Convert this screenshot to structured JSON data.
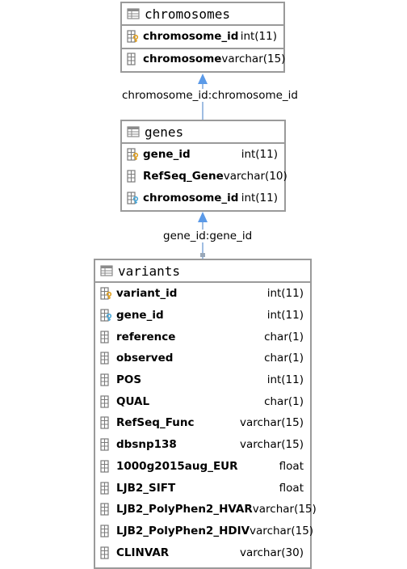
{
  "tables": {
    "chromosomes": {
      "title": "chromosomes",
      "rows": [
        {
          "name": "chromosome_id",
          "type": "int(11)",
          "icon": "primary-key-icon"
        },
        {
          "name": "chromosome",
          "type": "varchar(15)",
          "icon": "column-icon"
        }
      ]
    },
    "genes": {
      "title": "genes",
      "rows": [
        {
          "name": "gene_id",
          "type": "int(11)",
          "icon": "primary-key-icon"
        },
        {
          "name": "RefSeq_Gene",
          "type": "varchar(10)",
          "icon": "column-icon"
        },
        {
          "name": "chromosome_id",
          "type": "int(11)",
          "icon": "foreign-key-icon"
        }
      ]
    },
    "variants": {
      "title": "variants",
      "rows": [
        {
          "name": "variant_id",
          "type": "int(11)",
          "icon": "primary-key-icon"
        },
        {
          "name": "gene_id",
          "type": "int(11)",
          "icon": "foreign-key-icon"
        },
        {
          "name": "reference",
          "type": "char(1)",
          "icon": "column-icon"
        },
        {
          "name": "observed",
          "type": "char(1)",
          "icon": "column-icon"
        },
        {
          "name": "POS",
          "type": "int(11)",
          "icon": "column-icon"
        },
        {
          "name": "QUAL",
          "type": "char(1)",
          "icon": "column-icon"
        },
        {
          "name": "RefSeq_Func",
          "type": "varchar(15)",
          "icon": "column-icon"
        },
        {
          "name": "dbsnp138",
          "type": "varchar(15)",
          "icon": "column-icon"
        },
        {
          "name": "1000g2015aug_EUR",
          "type": "float",
          "icon": "column-icon"
        },
        {
          "name": "LJB2_SIFT",
          "type": "float",
          "icon": "column-icon"
        },
        {
          "name": "LJB2_PolyPhen2_HVAR",
          "type": "varchar(15)",
          "icon": "column-icon"
        },
        {
          "name": "LJB2_PolyPhen2_HDIV",
          "type": "varchar(15)",
          "icon": "column-icon"
        },
        {
          "name": "CLINVAR",
          "type": "varchar(30)",
          "icon": "column-icon"
        }
      ]
    }
  },
  "relations": {
    "genes_to_chromosomes": "chromosome_id:chromosome_id",
    "variants_to_genes": "gene_id:gene_id"
  },
  "colors": {
    "border": "#9a9a9a",
    "arrow": "#5b9ae8",
    "key": "#e0a020",
    "foreign_key": "#4aa8d8"
  }
}
